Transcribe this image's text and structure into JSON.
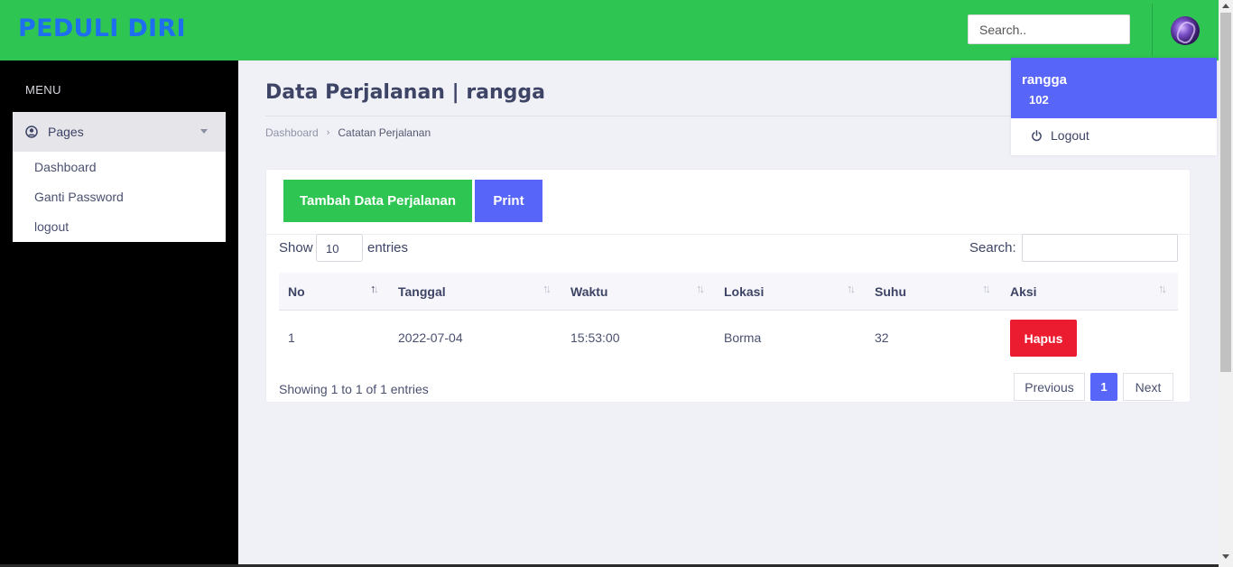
{
  "header": {
    "brand": "PEDULI DIRI",
    "search_placeholder": "Search..",
    "avatar_icon": "user-avatar",
    "bg_color": "#2fc552",
    "brand_color": "#1e6ff0"
  },
  "user_dropdown": {
    "name": "rangga",
    "id": "102",
    "logout_label": "Logout",
    "logout_icon": "power-icon"
  },
  "sidebar": {
    "menu_title": "MENU",
    "pages_label": "Pages",
    "pages_icon": "user-circle-icon",
    "items": [
      {
        "label": "Dashboard"
      },
      {
        "label": "Ganti Password"
      },
      {
        "label": "logout"
      }
    ]
  },
  "page": {
    "title": "Data Perjalanan | rangga",
    "breadcrumb": [
      "Dashboard",
      "Catatan Perjalanan"
    ]
  },
  "toolbar": {
    "add_label": "Tambah Data Perjalanan",
    "print_label": "Print"
  },
  "table_controls": {
    "show_label": "Show",
    "entries_value": "10",
    "entries_label": "entries",
    "search_label": "Search:"
  },
  "table": {
    "columns": [
      "No",
      "Tanggal",
      "Waktu",
      "Lokasi",
      "Suhu",
      "Aksi"
    ],
    "rows": [
      {
        "no": "1",
        "tanggal": "2022-07-04",
        "waktu": "15:53:00",
        "lokasi": "Borma",
        "suhu": "32",
        "aksi": "Hapus"
      }
    ]
  },
  "footer": {
    "showing": "Showing 1 to 1 of 1 entries",
    "prev_label": "Previous",
    "page_current": "1",
    "next_label": "Next"
  },
  "colors": {
    "primary": "#5865f9",
    "success": "#2fc552",
    "danger": "#ec1c30"
  }
}
